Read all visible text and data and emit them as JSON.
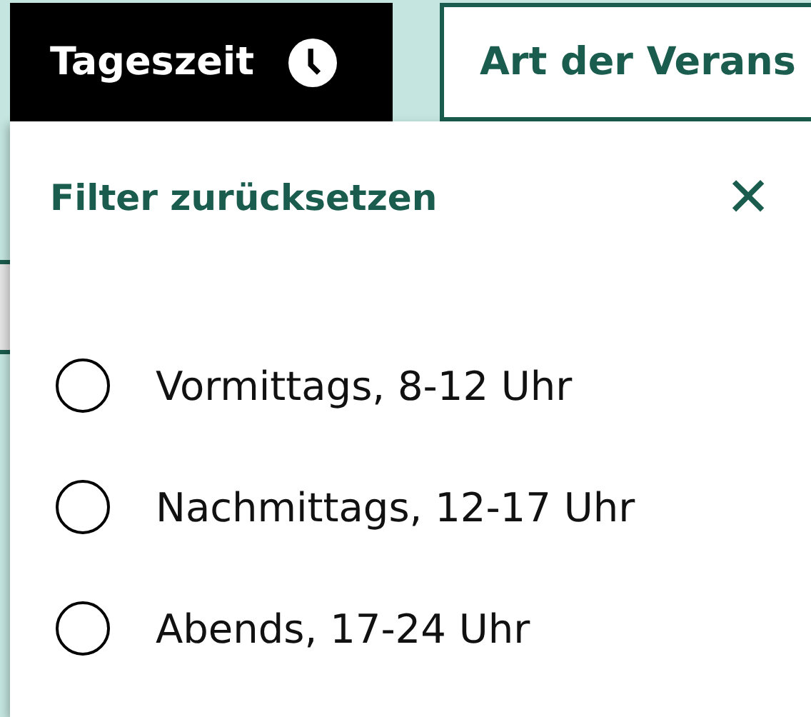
{
  "tabs": [
    {
      "label": "Tageszeit",
      "selected": true,
      "kind": "time"
    },
    {
      "label": "Art der Verans",
      "selected": false,
      "kind": "plain"
    }
  ],
  "dropdown": {
    "reset_label": "Filter zurücksetzen",
    "close": "✕",
    "options": [
      {
        "label": "Vormittags, 8-12 Uhr",
        "selected": false
      },
      {
        "label": "Nachmittags, 12-17 Uhr",
        "selected": false
      },
      {
        "label": "Abends, 17-24 Uhr",
        "selected": false
      }
    ]
  }
}
